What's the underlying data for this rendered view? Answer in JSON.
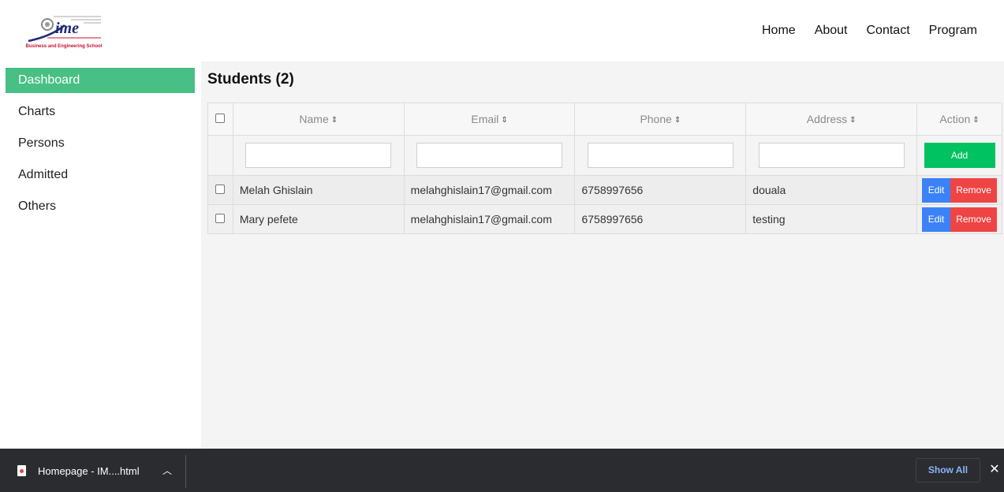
{
  "header": {
    "logo_text": "ime",
    "logo_subtitle": "Business and Engineering School",
    "nav": [
      {
        "label": "Home"
      },
      {
        "label": "About"
      },
      {
        "label": "Contact"
      },
      {
        "label": "Program"
      }
    ]
  },
  "sidebar": {
    "items": [
      {
        "label": "Dashboard",
        "active": true
      },
      {
        "label": "Charts"
      },
      {
        "label": "Persons"
      },
      {
        "label": "Admitted"
      },
      {
        "label": "Others"
      }
    ]
  },
  "main": {
    "title": "Students (2)",
    "table": {
      "columns": [
        "Name",
        "Email",
        "Phone",
        "Address",
        "Action"
      ],
      "add_label": "Add",
      "rows": [
        {
          "name": "Melah Ghislain",
          "email": "melahghislain17@gmail.com",
          "phone": "6758997656",
          "address": "douala"
        },
        {
          "name": "Mary pefete",
          "email": "melahghislain17@gmail.com",
          "phone": "6758997656",
          "address": "testing"
        }
      ],
      "edit_label": "Edit",
      "remove_label": "Remove"
    }
  },
  "download_bar": {
    "file_name": "Homepage - IM....html",
    "show_all_label": "Show All"
  },
  "colors": {
    "active_sidebar": "#48bf84",
    "add_button": "#00c261",
    "edit_button": "#3b82f6",
    "remove_button": "#ef4444"
  }
}
